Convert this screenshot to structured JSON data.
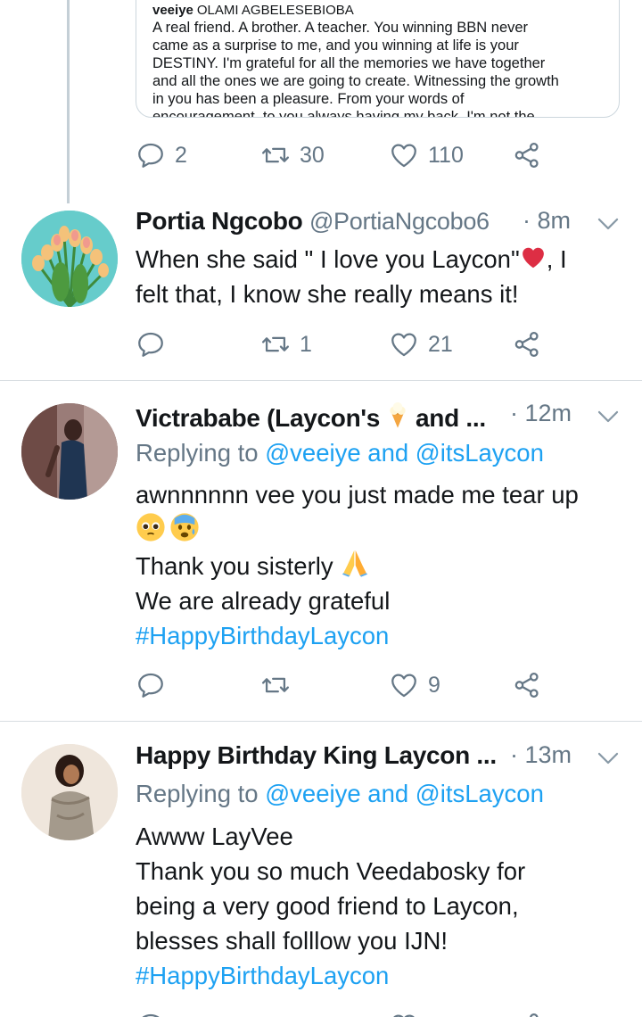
{
  "quoted": {
    "author": "veeiye",
    "name": "OLAMI AGBELESEBIOBA",
    "lines": [
      "A real friend. A brother. A teacher. You winning BBN never",
      "came as a surprise to me, and you winning at life is your",
      "DESTINY. I'm grateful for all the memories we have together",
      "and all the ones we are going to create. Witnessing the growth",
      "in you has been a pleasure. From your words of",
      "encouragement, to you always having my back. I'm not the"
    ]
  },
  "main_actions": {
    "replies": "2",
    "retweets": "30",
    "likes": "110"
  },
  "tweets": [
    {
      "name": "Portia Ngcobo",
      "handle": "@PortiaNgcobo6",
      "time": "· 8m",
      "body_line1": "When she said \" I love you Laycon\"",
      "body_line1_after": ", I",
      "body_line2": "felt that, I know she really means it!",
      "replies": "",
      "retweets": "1",
      "likes": "21"
    },
    {
      "name": "Victrababe (Laycon's",
      "name_after": "and ...",
      "time": "· 12m",
      "replying_prefix": "Replying to",
      "replying_mentions": "@veeiye and @itsLaycon",
      "body_line1": "awnnnnnn vee you just made me tear up",
      "body_line3": "Thank you sisterly",
      "body_line4": "We are already grateful",
      "hashtag": "#HappyBirthdayLaycon",
      "replies": "",
      "retweets": "",
      "likes": "9"
    },
    {
      "name": "Happy Birthday King Laycon ...",
      "time": "· 13m",
      "replying_prefix": "Replying to",
      "replying_mentions": "@veeiye and @itsLaycon",
      "body_line1": "Awww LayVee",
      "body_line2": "Thank you so much Veedabosky for",
      "body_line3": "being a very good friend to Laycon,",
      "body_line4": "blesses shall folllow you IJN!",
      "hashtag": "#HappyBirthdayLaycon"
    }
  ],
  "colors": {
    "accent": "#1da1f2",
    "muted": "#657786",
    "text": "#14171a",
    "heart": "#e0245e"
  },
  "icons": [
    "reply-icon",
    "retweet-icon",
    "like-icon",
    "share-icon",
    "chevron-down-icon",
    "heart-emoji",
    "ice-cream-emoji",
    "pleading-face-emoji",
    "anxious-face-emoji",
    "folded-hands-emoji"
  ]
}
